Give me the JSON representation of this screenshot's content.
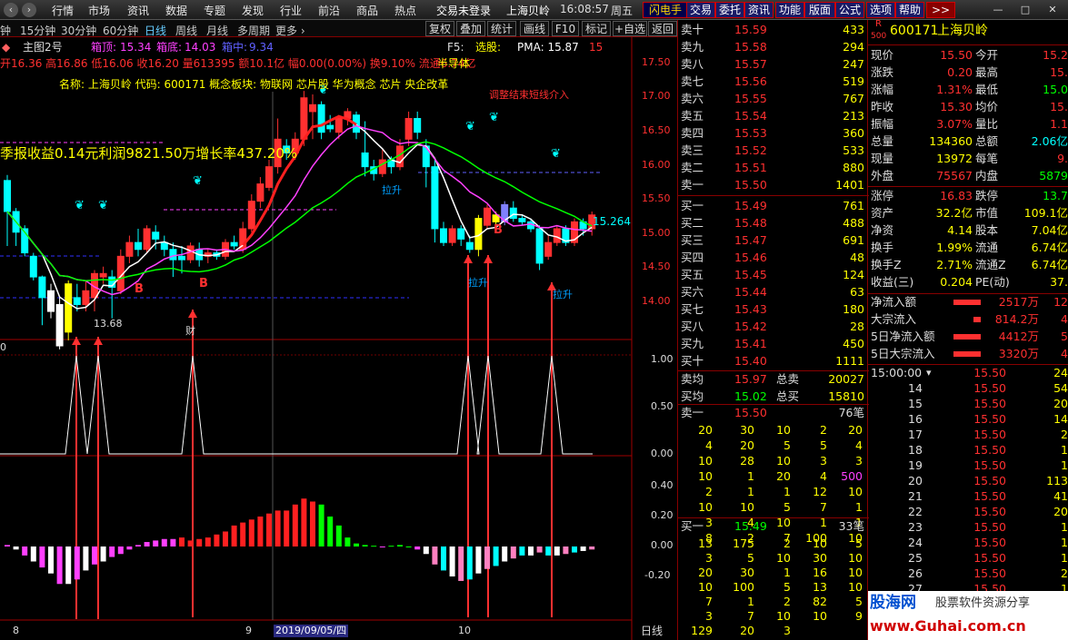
{
  "menu": [
    "行情",
    "市场",
    "资讯",
    "数据",
    "专题",
    "发现",
    "行业",
    "前沿",
    "商品",
    "热点"
  ],
  "login": "交易未登录",
  "exchange": "上海贝岭",
  "time": "16:08:57",
  "weekday": "周五",
  "toolbar": [
    "闪电手",
    "交易",
    "委托",
    "资讯",
    "功能",
    "版面",
    "公式",
    "选项",
    "帮助"
  ],
  "toolbar_more": ">>",
  "periods": [
    "钟",
    "15分钟",
    "30分钟",
    "60分钟",
    "日线",
    "周线",
    "月线",
    "多周期",
    "更多 ›"
  ],
  "actions": [
    "复权",
    "叠加",
    "统计",
    "画线",
    "F10",
    "标记",
    "+自选",
    "返回"
  ],
  "chart": {
    "title_label": "主图2号",
    "top_label": "箱顶:",
    "top_value": "15.34",
    "bottom_label": "箱底:",
    "bottom_value": "14.03",
    "mid_label": "箱中:",
    "mid_value": "9.34",
    "f5": "F5:",
    "xuangu": "选股:",
    "pma": "PMA: 15.87",
    "fifteen": "15",
    "ohlc": "开16.36 高16.86 低16.06 收16.20 量613395 额10.1亿 幅0.00(0.00%) 换9.10% 流通6.74亿",
    "sector": "半导体",
    "info_name": "名称: 上海贝岭 代码: 600171 概念板块: 物联网 芯片股 华为概念 芯片 央企改革",
    "earnings": "季报收益0.14元利润9821.50万增长率437.20%",
    "note": "调整结束短线介入",
    "la1": "拉升",
    "la2": "拉升",
    "la3": "拉升",
    "last": "15.264",
    "low_label": "13.68",
    "cai": "财",
    "b_labels": [
      "B",
      "B",
      "B"
    ],
    "ind_zero": "0",
    "date_hl": "2019/09/05/四",
    "month_labels": [
      "8",
      "9",
      "10"
    ],
    "period": "日线"
  },
  "price_axis": [
    "17.50",
    "17.00",
    "16.50",
    "16.00",
    "15.50",
    "15.00",
    "14.50",
    "14.00"
  ],
  "ind1_axis": [
    "1.00",
    "0.50",
    "0.00"
  ],
  "ind2_axis": [
    "0.40",
    "0.20",
    "0.00",
    "-0.20"
  ],
  "asks": [
    [
      "卖十",
      "15.59",
      "433"
    ],
    [
      "卖九",
      "15.58",
      "294"
    ],
    [
      "卖八",
      "15.57",
      "247"
    ],
    [
      "卖七",
      "15.56",
      "519"
    ],
    [
      "卖六",
      "15.55",
      "767"
    ],
    [
      "卖五",
      "15.54",
      "213"
    ],
    [
      "卖四",
      "15.53",
      "360"
    ],
    [
      "卖三",
      "15.52",
      "533"
    ],
    [
      "卖二",
      "15.51",
      "880"
    ],
    [
      "卖一",
      "15.50",
      "1401"
    ]
  ],
  "bids": [
    [
      "买一",
      "15.49",
      "761"
    ],
    [
      "买二",
      "15.48",
      "488"
    ],
    [
      "买三",
      "15.47",
      "691"
    ],
    [
      "买四",
      "15.46",
      "48"
    ],
    [
      "买五",
      "15.45",
      "124"
    ],
    [
      "买六",
      "15.44",
      "63"
    ],
    [
      "买七",
      "15.43",
      "180"
    ],
    [
      "买八",
      "15.42",
      "28"
    ],
    [
      "买九",
      "15.41",
      "450"
    ],
    [
      "买十",
      "15.40",
      "1111"
    ]
  ],
  "avg": [
    [
      "卖均",
      "15.97",
      "总卖",
      "20027"
    ],
    [
      "买均",
      "15.02",
      "总买",
      "15810"
    ]
  ],
  "queue_sell_head": [
    "卖一",
    "15.50",
    "76笔"
  ],
  "queue_sell": [
    [
      "20",
      "30",
      "10",
      "2",
      "20"
    ],
    [
      "4",
      "20",
      "5",
      "5",
      "4"
    ],
    [
      "10",
      "28",
      "10",
      "3",
      "3"
    ],
    [
      "10",
      "1",
      "20",
      "4",
      "500"
    ],
    [
      "2",
      "1",
      "1",
      "12",
      "10"
    ],
    [
      "10",
      "10",
      "5",
      "7",
      "1"
    ],
    [
      "3",
      "4",
      "10",
      "1",
      "1"
    ],
    [
      "8",
      "2",
      "7",
      "100",
      "10"
    ]
  ],
  "queue_buy_head": [
    "买一",
    "15.49",
    "33笔"
  ],
  "queue_buy": [
    [
      "13",
      "175",
      "2",
      "10",
      "5"
    ],
    [
      "3",
      "5",
      "10",
      "30",
      "10"
    ],
    [
      "20",
      "30",
      "1",
      "16",
      "10"
    ],
    [
      "10",
      "100",
      "5",
      "13",
      "10"
    ],
    [
      "7",
      "1",
      "2",
      "82",
      "5"
    ],
    [
      "3",
      "7",
      "10",
      "10",
      "9"
    ],
    [
      "129",
      "20",
      "3",
      "",
      ""
    ]
  ],
  "stock": {
    "code": "600171",
    "name": "上海贝岭",
    "badge_r": "R",
    "badge_n": "500"
  },
  "quote": [
    [
      "现价",
      "15.50",
      "今开",
      "15.2"
    ],
    [
      "涨跌",
      "0.20",
      "最高",
      "15."
    ],
    [
      "涨幅",
      "1.31%",
      "最低",
      "15.0"
    ],
    [
      "昨收",
      "15.30",
      "均价",
      "15."
    ],
    [
      "振幅",
      "3.07%",
      "量比",
      "1.1"
    ],
    [
      "总量",
      "134360",
      "总额",
      "2.06亿"
    ],
    [
      "现量",
      "13972",
      "每笔",
      "9."
    ],
    [
      "外盘",
      "75567",
      "内盘",
      "5879"
    ]
  ],
  "quote2": [
    [
      "涨停",
      "16.83",
      "跌停",
      "13.7"
    ],
    [
      "资产",
      "32.2亿",
      "市值",
      "109.1亿"
    ],
    [
      "净资",
      "4.14",
      "股本",
      "7.04亿"
    ],
    [
      "换手",
      "1.99%",
      "流通",
      "6.74亿"
    ],
    [
      "换手Z",
      "2.71%",
      "流通Z",
      "6.74亿"
    ],
    [
      "收益(三)",
      "0.204",
      "PE(动)",
      "37."
    ]
  ],
  "flow": [
    [
      "净流入额",
      "2517万",
      "12"
    ],
    [
      "大宗流入",
      "814.2万",
      "4"
    ],
    [
      "5日净流入额",
      "4412万",
      "5"
    ],
    [
      "5日大宗流入",
      "3320万",
      "4"
    ]
  ],
  "ticks": [
    [
      "15:00:00",
      "15.50",
      "24"
    ],
    [
      "14",
      "15.50",
      "54"
    ],
    [
      "15",
      "15.50",
      "20"
    ],
    [
      "16",
      "15.50",
      "14"
    ],
    [
      "17",
      "15.50",
      "2"
    ],
    [
      "18",
      "15.50",
      "1"
    ],
    [
      "19",
      "15.50",
      "1"
    ],
    [
      "20",
      "15.50",
      "113"
    ],
    [
      "21",
      "15.50",
      "41"
    ],
    [
      "22",
      "15.50",
      "20"
    ],
    [
      "23",
      "15.50",
      "1"
    ],
    [
      "24",
      "15.50",
      "1"
    ],
    [
      "25",
      "15.50",
      "1"
    ],
    [
      "26",
      "15.50",
      "2"
    ],
    [
      "27",
      "15.50",
      "1"
    ]
  ],
  "watermark": {
    "line1": "股海网",
    "line2": "股票软件资源分享",
    "line3": "www.Guhai.com.cn"
  },
  "colors": {
    "up": "#ff3030",
    "down": "#00ffff",
    "text": "#c0c0c0",
    "yellow": "#ffff00",
    "bg": "#000000"
  }
}
